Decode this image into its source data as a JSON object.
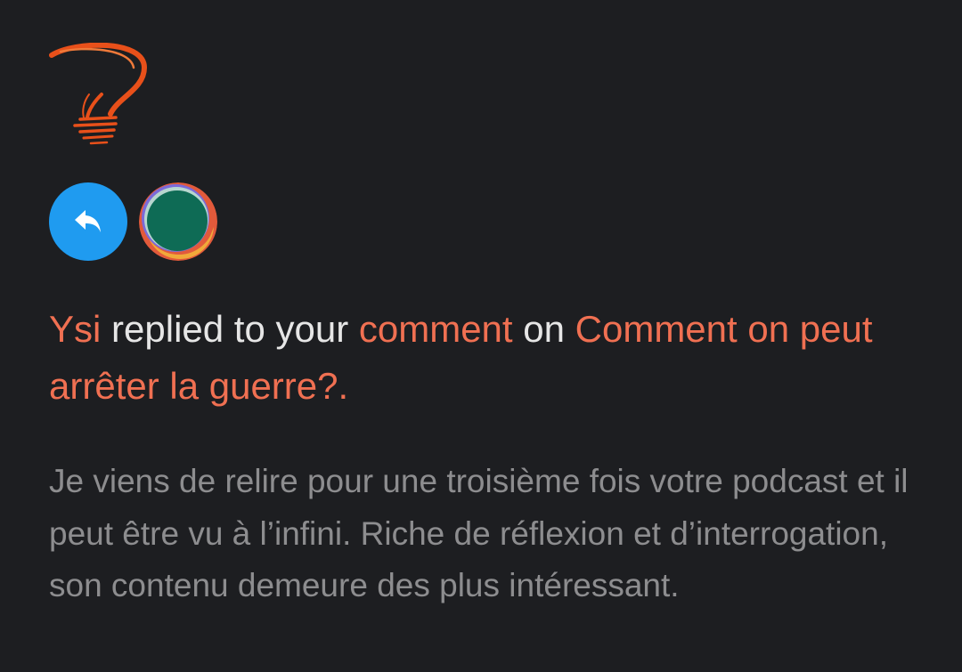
{
  "logo": {
    "icon": "lightbulb-question-icon",
    "color": "#e8501a"
  },
  "reply_badge": {
    "icon": "reply-arrow-icon",
    "color": "#1f9bf0"
  },
  "avatar": {
    "icon": "user-avatar",
    "colors": [
      "#0e6b55",
      "#f0a93a",
      "#e25a3b",
      "#7b6ad8"
    ]
  },
  "notification": {
    "actor": "Ysi",
    "action_text": "replied to your",
    "target_link": "comment",
    "connector": "on",
    "post_title": "Comment on peut arrêter la guerre?",
    "end_punct": ".",
    "excerpt": "Je viens de relire pour une troisième fois votre podcast et il peut être vu à l’infini. Riche de réflexion et d’interrogation, son contenu demeure des plus intéressant."
  },
  "colors": {
    "background": "#1d1e21",
    "link": "#f07052",
    "text": "#e6e6e6",
    "muted": "#8d8d8f"
  }
}
